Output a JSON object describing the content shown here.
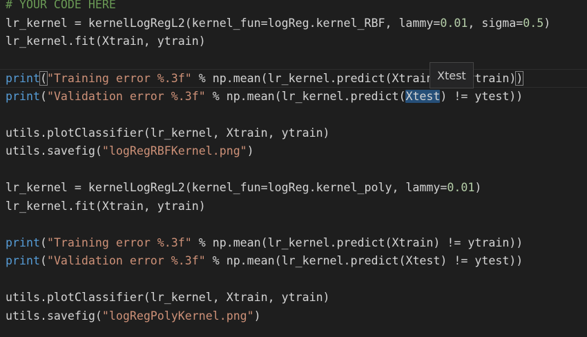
{
  "colors": {
    "background": "#1e1e1e",
    "comment": "#6a9955",
    "keyword": "#569cd6",
    "string": "#ce9178",
    "number": "#b5cea8",
    "text": "#d4d4d4"
  },
  "hover_tooltip": {
    "text": "Xtest"
  },
  "code": {
    "l1": {
      "comment": "# YOUR CODE HERE"
    },
    "l2": {
      "a": "lr_kernel = kernelLogRegL2(kernel_fun=logReg.kernel_RBF, lammy=",
      "n1": "0.01",
      "b": ", sigma=",
      "n2": "0.5",
      "c": ")"
    },
    "l3": {
      "a": "lr_kernel.fit(Xtrain, ytrain)"
    },
    "l5": {
      "kw": "print",
      "p1": "(",
      "s": "\"Training error %.3f\"",
      "a": " % np.mean(lr_kernel.predict(Xt",
      "hidden": "rain) !",
      "b": "= ytrain)",
      "p2": ")"
    },
    "l6": {
      "kw": "print",
      "p1": "(",
      "s": "\"Validation error %.3f\"",
      "a": " % np.mean(lr_kernel.predict(",
      "w": "Xtest",
      "b": ") != ytest))"
    },
    "l8": {
      "a": "utils.plotClassifier(lr_kernel, Xtrain, ytrain)"
    },
    "l9": {
      "a": "utils.savefig(",
      "s": "\"logRegRBFKernel.png\"",
      "b": ")"
    },
    "l11": {
      "a": "lr_kernel = kernelLogRegL2(kernel_fun=logReg.kernel_poly, lammy=",
      "n1": "0.01",
      "b": ")"
    },
    "l12": {
      "a": "lr_kernel.fit(Xtrain, ytrain)"
    },
    "l14": {
      "kw": "print",
      "p1": "(",
      "s": "\"Training error %.3f\"",
      "a": " % np.mean(lr_kernel.predict(Xtrain) != ytrain))"
    },
    "l15": {
      "kw": "print",
      "p1": "(",
      "s": "\"Validation error %.3f\"",
      "a": " % np.mean(lr_kernel.predict(Xtest) != ytest))"
    },
    "l17": {
      "a": "utils.plotClassifier(lr_kernel, Xtrain, ytrain)"
    },
    "l18": {
      "a": "utils.savefig(",
      "s": "\"logRegPolyKernel.png\"",
      "b": ")"
    }
  }
}
